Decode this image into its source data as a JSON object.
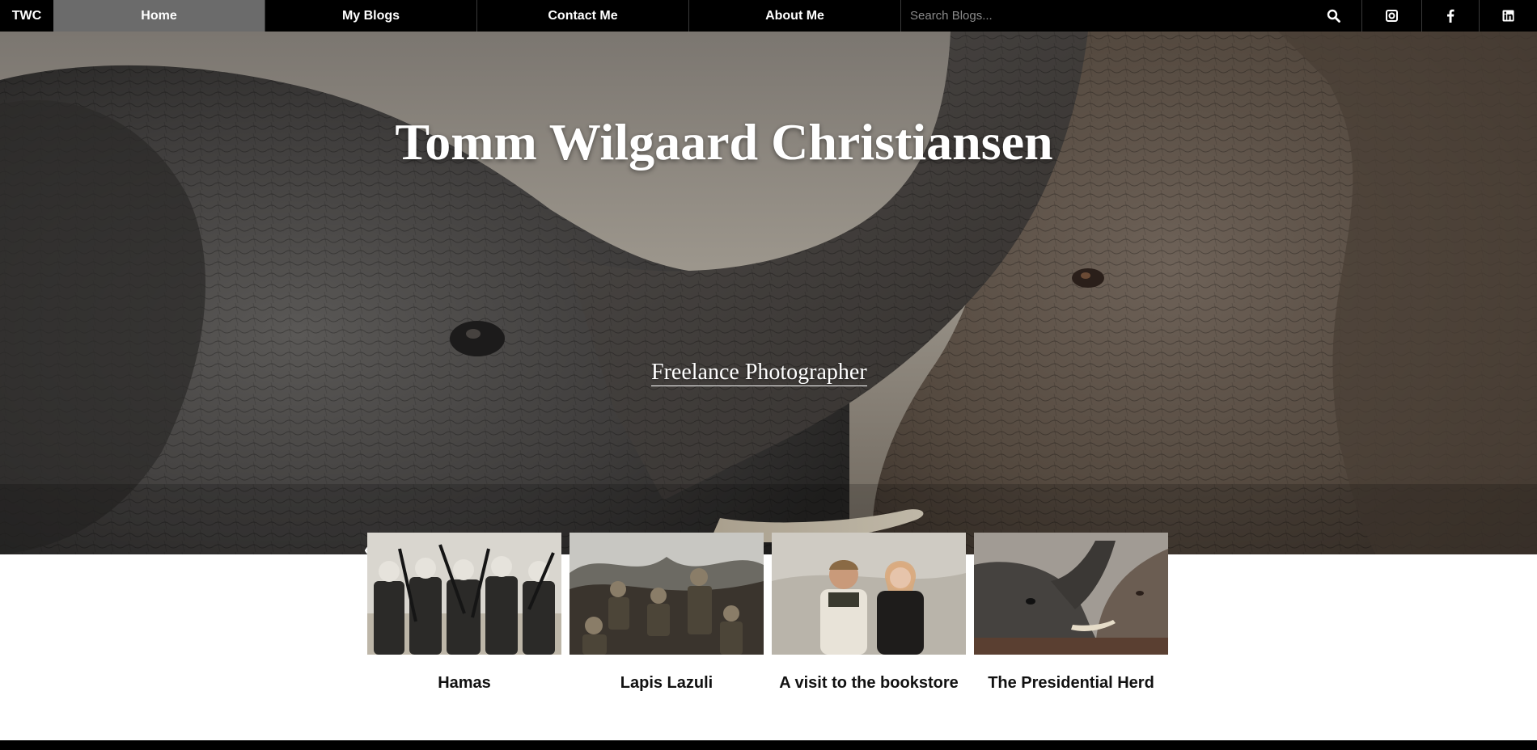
{
  "nav": {
    "brand": "TWC",
    "items": [
      {
        "label": "Home",
        "active": true
      },
      {
        "label": "My Blogs",
        "active": false
      },
      {
        "label": "Contact Me",
        "active": false
      },
      {
        "label": "About Me",
        "active": false
      }
    ],
    "search_placeholder": "Search Blogs...",
    "search_value": "",
    "social_icons": [
      "camera-icon",
      "facebook-icon",
      "linkedin-icon"
    ]
  },
  "hero": {
    "title": "Tomm Wilgaard Christiansen",
    "subtitle": "Freelance Photographer",
    "prev_arrow": "‹",
    "next_arrow": "›"
  },
  "cards": [
    {
      "title": "Hamas"
    },
    {
      "title": "Lapis Lazuli"
    },
    {
      "title": "A visit to the bookstore"
    },
    {
      "title": "The Presidential Herd"
    }
  ],
  "colors": {
    "nav_background": "#000000",
    "nav_active": "#6b6b6b",
    "text_light": "#ffffff",
    "card_title": "#111111"
  }
}
